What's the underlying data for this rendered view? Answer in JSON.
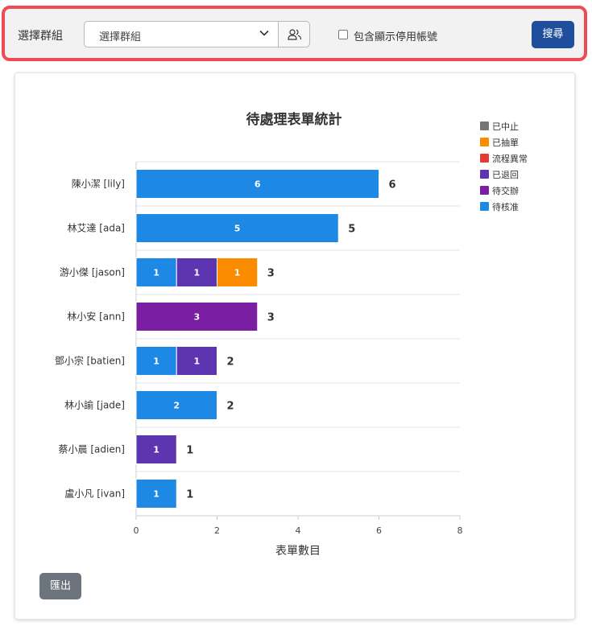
{
  "filter": {
    "group_label": "選擇群組",
    "select_value": "選擇群組",
    "include_disabled_label": "包含顯示停用帳號",
    "include_disabled_checked": false,
    "search_label": "搜尋",
    "icons": {
      "chevron": "chevron-down-icon",
      "group": "people-icon"
    }
  },
  "export_label": "匯出",
  "chart_data": {
    "type": "bar",
    "orientation": "horizontal",
    "stacked": true,
    "title": "待處理表單統計",
    "xlabel": "表單數目",
    "ylabel": "",
    "xlim": [
      0,
      8
    ],
    "xticks": [
      0,
      2,
      4,
      6,
      8
    ],
    "grid": true,
    "legend_position": "right",
    "categories": [
      "陳小潔 [lily]",
      "林艾達 [ada]",
      "游小傑 [jason]",
      "林小安 [ann]",
      "鄧小宗 [batien]",
      "林小諭 [jade]",
      "蔡小晨 [adien]",
      "盧小凡 [ivan]"
    ],
    "totals": [
      6,
      5,
      3,
      3,
      2,
      2,
      1,
      1
    ],
    "series": [
      {
        "name": "待核准",
        "color": "#1e88e5",
        "values": [
          6,
          5,
          1,
          0,
          1,
          2,
          0,
          1
        ]
      },
      {
        "name": "待交辦",
        "color": "#7b1fa2",
        "values": [
          0,
          0,
          0,
          3,
          0,
          0,
          0,
          0
        ]
      },
      {
        "name": "已退回",
        "color": "#5e35b1",
        "values": [
          0,
          0,
          1,
          0,
          1,
          0,
          1,
          0
        ]
      },
      {
        "name": "流程異常",
        "color": "#e53935",
        "values": [
          0,
          0,
          0,
          0,
          0,
          0,
          0,
          0
        ]
      },
      {
        "name": "已抽單",
        "color": "#fb8c00",
        "values": [
          0,
          0,
          1,
          0,
          0,
          0,
          0,
          0
        ]
      },
      {
        "name": "已中止",
        "color": "#757575",
        "values": [
          0,
          0,
          0,
          0,
          0,
          0,
          0,
          0
        ]
      }
    ],
    "legend_order": [
      "已中止",
      "已抽單",
      "流程異常",
      "已退回",
      "待交辦",
      "待核准"
    ]
  }
}
